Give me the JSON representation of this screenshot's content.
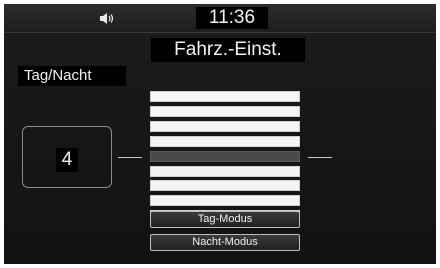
{
  "status_bar": {
    "time": "11:36",
    "icons": [
      "speaker-icon"
    ]
  },
  "screen": {
    "title": "Fahrz.-Einst.",
    "section_label": "Tag/Nacht"
  },
  "setting": {
    "value": "4",
    "level_count": 9,
    "selected_index": 4
  },
  "buttons": {
    "day_mode": "Tag-Modus",
    "night_mode": "Nacht-Modus"
  },
  "colors": {
    "background": "#161616",
    "text": "#f2f2f2",
    "bar": "#f4f4f4",
    "bar_selected": "#4a4a4a"
  }
}
